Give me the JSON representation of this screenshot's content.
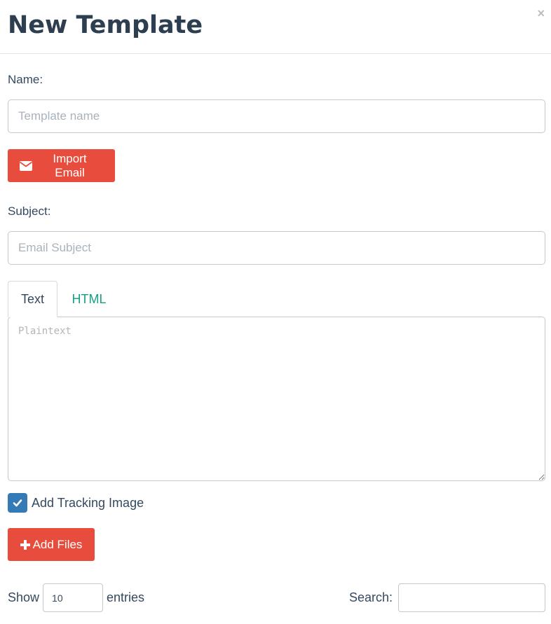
{
  "modal": {
    "title": "New Template",
    "close_glyph": "×"
  },
  "form": {
    "name_label": "Name:",
    "name_input": {
      "value": "",
      "placeholder": "Template name"
    },
    "import_button": {
      "label": "Import Email",
      "icon": "envelope-icon"
    },
    "subject_label": "Subject:",
    "subject_input": {
      "value": "",
      "placeholder": "Email Subject"
    },
    "tabs": [
      {
        "label": "Text",
        "active": true
      },
      {
        "label": "HTML",
        "active": false
      }
    ],
    "editor": {
      "value": "",
      "placeholder": "Plaintext"
    },
    "tracking_checkbox": {
      "label": "Add Tracking Image",
      "checked": true
    },
    "add_files_button": {
      "label": "Add Files",
      "icon": "plus-icon"
    }
  },
  "datatable": {
    "show_label": "Show",
    "length_value": "10",
    "entries_label": "entries",
    "search_label": "Search:",
    "search_value": ""
  },
  "colors": {
    "accent_red": "#e74c3c",
    "tab_link": "#16a085",
    "checkbox_blue": "#337ab7",
    "text": "#34495e"
  }
}
